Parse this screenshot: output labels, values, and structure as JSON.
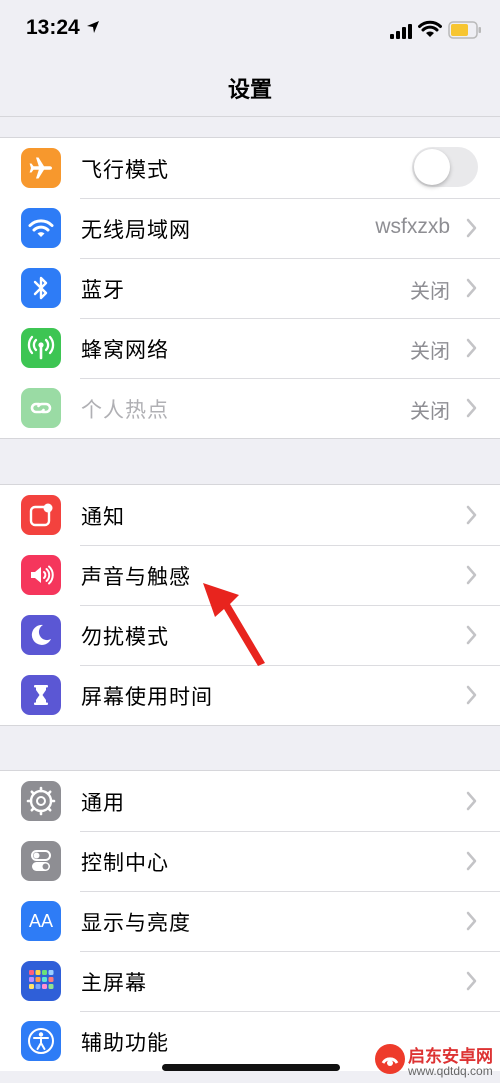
{
  "status": {
    "time": "13:24"
  },
  "nav": {
    "title": "设置"
  },
  "group1": [
    {
      "label": "飞行模式",
      "icon": "airplane-icon",
      "color": "#f7982d",
      "toggle": false
    },
    {
      "label": "无线局域网",
      "icon": "wifi-icon",
      "color": "#2e7cf6",
      "value": "wsfxzxb"
    },
    {
      "label": "蓝牙",
      "icon": "bluetooth-icon",
      "color": "#2e7cf6",
      "value": "关闭"
    },
    {
      "label": "蜂窝网络",
      "icon": "cellular-icon",
      "color": "#3dc553",
      "value": "关闭"
    },
    {
      "label": "个人热点",
      "icon": "hotspot-icon",
      "color": "#9adba4",
      "value": "关闭",
      "disabled": true
    }
  ],
  "group2": [
    {
      "label": "通知",
      "icon": "notifications-icon",
      "color": "#f3423e"
    },
    {
      "label": "声音与触感",
      "icon": "sound-icon",
      "color": "#f5365c"
    },
    {
      "label": "勿扰模式",
      "icon": "moon-icon",
      "color": "#5b57d4"
    },
    {
      "label": "屏幕使用时间",
      "icon": "hourglass-icon",
      "color": "#5b57d4"
    }
  ],
  "group3": [
    {
      "label": "通用",
      "icon": "gear-icon",
      "color": "#8e8e93"
    },
    {
      "label": "控制中心",
      "icon": "toggles-icon",
      "color": "#8e8e93"
    },
    {
      "label": "显示与亮度",
      "icon": "aa-icon",
      "color": "#2e7cf6",
      "icon_text": "AA"
    },
    {
      "label": "主屏幕",
      "icon": "home-grid-icon",
      "color": "#2f5fd8"
    },
    {
      "label": "辅助功能",
      "icon": "accessibility-icon",
      "color": "#2e7cf6"
    }
  ],
  "watermark": {
    "text": "启东安卓网",
    "url": "www.qdtdq.com"
  }
}
